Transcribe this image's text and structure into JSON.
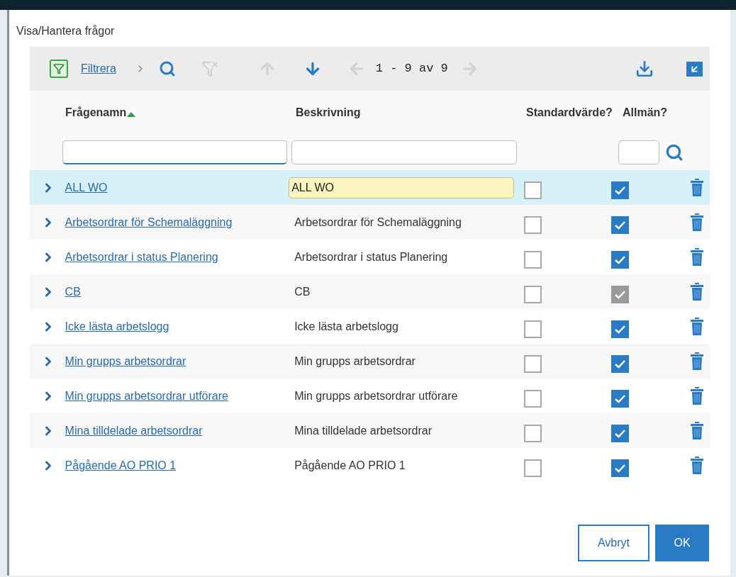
{
  "dialog": {
    "title": "Visa/Hantera frågor"
  },
  "toolbar": {
    "filter_link": "Filtrera",
    "pagination": "1 - 9 av 9"
  },
  "columns": [
    {
      "label": "Frågenamn",
      "sorted": true
    },
    {
      "label": "Beskrivning",
      "sorted": false
    },
    {
      "label": "Standardvärde?",
      "sorted": false
    },
    {
      "label": "Allmän?",
      "sorted": false
    }
  ],
  "rows": [
    {
      "name": "ALL WO",
      "description": "ALL WO",
      "standard": false,
      "general": true,
      "general_disabled": false,
      "selected": true
    },
    {
      "name": "Arbetsordrar för Schemaläggning",
      "description": "Arbetsordrar för Schemaläggning",
      "standard": false,
      "general": true,
      "general_disabled": false,
      "selected": false
    },
    {
      "name": "Arbetsordrar i status Planering",
      "description": "Arbetsordrar i status Planering",
      "standard": false,
      "general": true,
      "general_disabled": false,
      "selected": false
    },
    {
      "name": "CB",
      "description": "CB",
      "standard": false,
      "general": true,
      "general_disabled": true,
      "selected": false
    },
    {
      "name": "Icke lästa arbetslogg",
      "description": "Icke lästa arbetslogg",
      "standard": false,
      "general": true,
      "general_disabled": false,
      "selected": false
    },
    {
      "name": "Min grupps arbetsordrar",
      "description": "Min grupps arbetsordrar",
      "standard": false,
      "general": true,
      "general_disabled": false,
      "selected": false
    },
    {
      "name": "Min grupps arbetsordrar utförare",
      "description": "Min grupps arbetsordrar utförare",
      "standard": false,
      "general": true,
      "general_disabled": false,
      "selected": false
    },
    {
      "name": "Mina tilldelade arbetsordrar",
      "description": "Mina tilldelade arbetsordrar",
      "standard": false,
      "general": true,
      "general_disabled": false,
      "selected": false
    },
    {
      "name": "Pågående AO PRIO 1",
      "description": "Pågående AO PRIO 1",
      "standard": false,
      "general": true,
      "general_disabled": false,
      "selected": false
    }
  ],
  "buttons": [
    {
      "label": "Avbryt",
      "kind": "secondary"
    },
    {
      "label": "OK",
      "kind": "primary"
    }
  ]
}
